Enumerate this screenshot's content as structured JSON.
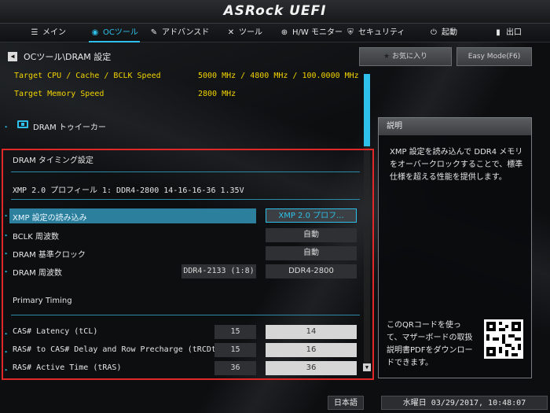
{
  "header": {
    "logo": "ASRock UEFI"
  },
  "nav": {
    "items": [
      {
        "icon": "menu-icon",
        "glyph": "☰",
        "label": "メイン",
        "active": false
      },
      {
        "icon": "oc-tool-icon",
        "glyph": "◉",
        "label": "OCツール",
        "active": true
      },
      {
        "icon": "advanced-icon",
        "glyph": "✎",
        "label": "アドバンスド",
        "active": false
      },
      {
        "icon": "tool-icon",
        "glyph": "✕",
        "label": "ツール",
        "active": false
      },
      {
        "icon": "hw-monitor-icon",
        "glyph": "⊕",
        "label": "H/W モニター",
        "active": false
      },
      {
        "icon": "security-icon",
        "glyph": "⛨",
        "label": "セキュリティ",
        "active": false
      },
      {
        "icon": "boot-icon",
        "glyph": "⏻",
        "label": "起動",
        "active": false
      },
      {
        "icon": "exit-icon",
        "glyph": "▮",
        "label": "出口",
        "active": false
      }
    ]
  },
  "breadcrumb": "OCツール\\DRAM 設定",
  "top_buttons": {
    "favorites": "お気に入り",
    "easy_mode": "Easy Mode(F6)"
  },
  "info": {
    "cpu_label": "Target CPU / Cache / BCLK Speed",
    "cpu_value": "5000 MHz / 4800 MHz / 100.0000 MHz",
    "mem_label": "Target Memory Speed",
    "mem_value": "2800 MHz"
  },
  "dram_tweaker": "DRAM トゥイーカー",
  "timing": {
    "section_title": "DRAM タイミング設定",
    "xmp_profile": "XMP 2.0 プロフィール 1: DDR4-2800 14-16-16-36 1.35V",
    "rows": [
      {
        "label": "XMP 設定の読み込み",
        "current": "",
        "value": "XMP 2.0 プロフ..."
      },
      {
        "label": "BCLK 周波数",
        "current": "",
        "value": "自動"
      },
      {
        "label": "DRAM 基準クロック",
        "current": "",
        "value": "自動"
      },
      {
        "label": "DRAM 周波数",
        "current": "DDR4-2133 (1:8)",
        "value": "DDR4-2800"
      }
    ],
    "primary_title": "Primary Timing",
    "primary_rows": [
      {
        "label": "CAS# Latency (tCL)",
        "current": "15",
        "value": "14"
      },
      {
        "label": "RAS# to CAS# Delay and Row Precharge (tRCDtRP)",
        "current": "15",
        "value": "16"
      },
      {
        "label": "RAS# Active Time (tRAS)",
        "current": "36",
        "value": "36"
      }
    ]
  },
  "description": {
    "title": "説明",
    "body": "XMP 設定を読み込んで DDR4 メモリをオーバークロックすることで、標準仕様を超える性能を提供します。",
    "qr_text": "このQRコードを使って、マザーボードの取扱説明書PDFをダウンロードできます。"
  },
  "footer": {
    "language": "日本語",
    "datetime": "水曜日 03/29/2017, 10:48:07"
  },
  "colors": {
    "accent": "#2ec0ea",
    "highlight_box": "#e02828",
    "info_yellow": "#f2d300"
  }
}
